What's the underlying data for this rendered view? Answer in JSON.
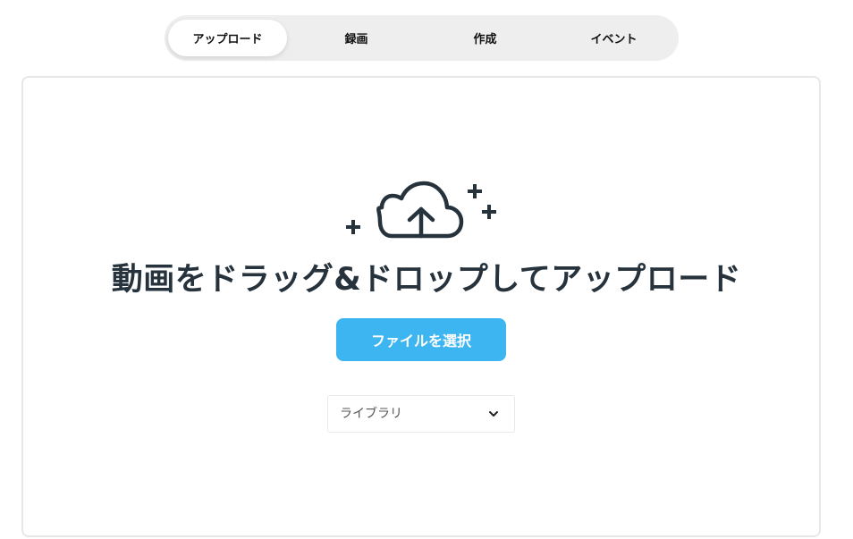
{
  "tabs": [
    {
      "label": "アップロード",
      "active": true
    },
    {
      "label": "録画",
      "active": false
    },
    {
      "label": "作成",
      "active": false
    },
    {
      "label": "イベント",
      "active": false
    }
  ],
  "dropzone": {
    "icon": "cloud-upload-icon",
    "headline": "動画をドラッグ&ドロップしてアップロード",
    "select_button_label": "ファイルを選択",
    "library_select": {
      "selected": "ライブラリ",
      "icon": "chevron-down-icon"
    }
  },
  "colors": {
    "accent": "#3db5f0",
    "text_dark": "#26323c",
    "tab_track": "#eeeeee",
    "border": "#e7e7e7"
  }
}
